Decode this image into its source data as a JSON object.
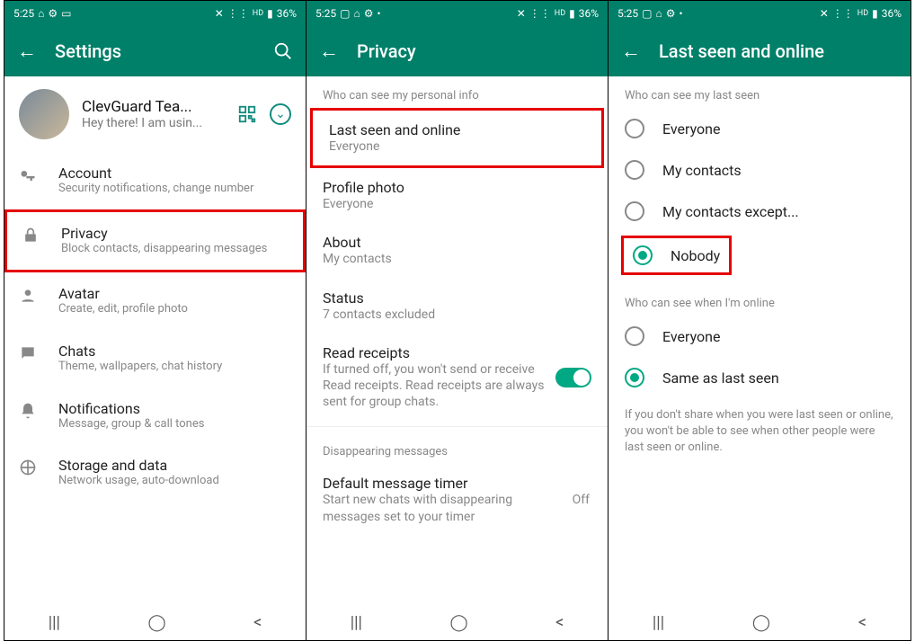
{
  "status": {
    "time": "5:25",
    "battery": "36%"
  },
  "phone1": {
    "title": "Settings",
    "profile_name": "ClevGuard Tea...",
    "profile_status": "Hey there! I am usin...",
    "items": [
      {
        "title": "Account",
        "sub": "Security notifications, change number"
      },
      {
        "title": "Privacy",
        "sub": "Block contacts, disappearing messages"
      },
      {
        "title": "Avatar",
        "sub": "Create, edit, profile photo"
      },
      {
        "title": "Chats",
        "sub": "Theme, wallpapers, chat history"
      },
      {
        "title": "Notifications",
        "sub": "Message, group & call tones"
      },
      {
        "title": "Storage and data",
        "sub": "Network usage, auto-download"
      }
    ]
  },
  "phone2": {
    "title": "Privacy",
    "section1": "Who can see my personal info",
    "last_seen": {
      "title": "Last seen and online",
      "sub": "Everyone"
    },
    "profile_photo": {
      "title": "Profile photo",
      "sub": "Everyone"
    },
    "about": {
      "title": "About",
      "sub": "My contacts"
    },
    "status": {
      "title": "Status",
      "sub": "7 contacts excluded"
    },
    "read_receipts": {
      "title": "Read receipts",
      "sub": "If turned off, you won't send or receive Read receipts. Read receipts are always sent for group chats."
    },
    "section2": "Disappearing messages",
    "default_timer": {
      "title": "Default message timer",
      "sub": "Start new chats with disappearing messages set to your timer",
      "value": "Off"
    }
  },
  "phone3": {
    "title": "Last seen and online",
    "section1": "Who can see my last seen",
    "options1": [
      "Everyone",
      "My contacts",
      "My contacts except...",
      "Nobody"
    ],
    "section2": "Who can see when I'm online",
    "options2": [
      "Everyone",
      "Same as last seen"
    ],
    "hint": "If you don't share when you were last seen or online, you won't be able to see when other people were last seen or online."
  }
}
